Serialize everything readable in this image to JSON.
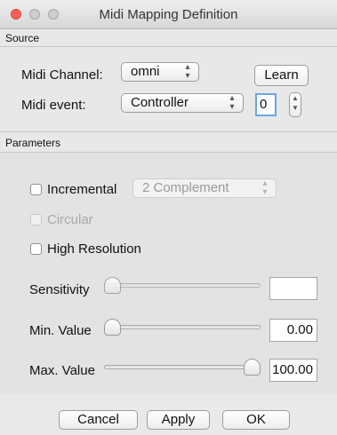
{
  "window": {
    "title": "Midi Mapping Definition"
  },
  "source": {
    "section_label": "Source",
    "midi_channel_label": "Midi Channel:",
    "midi_channel_value": "omni",
    "learn_label": "Learn",
    "midi_event_label": "Midi event:",
    "midi_event_value": "Controller",
    "controller_number": "0"
  },
  "parameters": {
    "section_label": "Parameters",
    "incremental_label": "Incremental",
    "incremental_mode_value": "2 Complement",
    "circular_label": "Circular",
    "high_resolution_label": "High Resolution",
    "sensitivity_label": "Sensitivity",
    "sensitivity_value": "",
    "min_value_label": "Min. Value",
    "min_value_value": "0.00",
    "max_value_label": "Max. Value",
    "max_value_value": "100.00",
    "sensitivity_level": 0,
    "min_level": 0,
    "max_level": 1
  },
  "buttons": {
    "cancel": "Cancel",
    "apply": "Apply",
    "ok": "OK"
  },
  "icons": {
    "close": "close-icon",
    "minimize": "minimize-icon",
    "maximize": "maximize-icon",
    "up_down": "updown-arrows-icon"
  }
}
